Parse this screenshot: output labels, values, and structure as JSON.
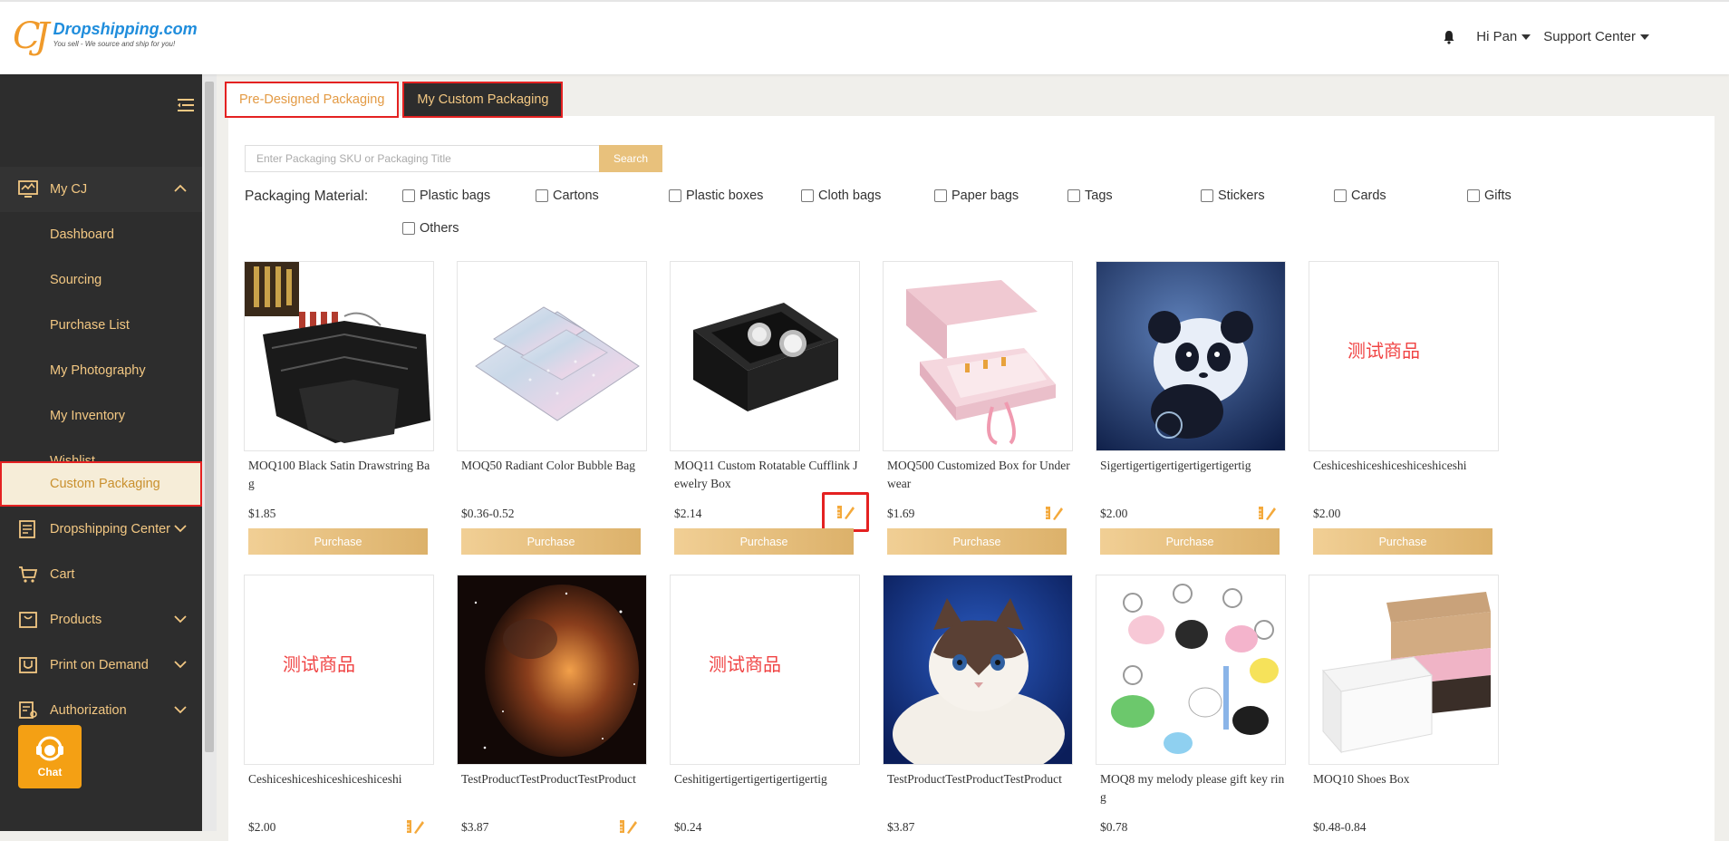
{
  "header": {
    "logo_mark": "CJ",
    "logo_name": "Dropshipping.com",
    "logo_tagline": "You sell - We source and ship for you!",
    "user_greeting": "Hi Pan",
    "support": "Support Center"
  },
  "sidebar": {
    "section_mycj": "My CJ",
    "sub_items": [
      "Dashboard",
      "Sourcing",
      "Purchase List",
      "My Photography",
      "My Inventory",
      "Wishlist",
      "Custom Packaging"
    ],
    "items": [
      "Dropshipping Center",
      "Cart",
      "Products",
      "Print on Demand",
      "Authorization"
    ],
    "chat": "Chat"
  },
  "tabs": {
    "pre_designed": "Pre-Designed Packaging",
    "my_custom": "My Custom Packaging"
  },
  "search": {
    "placeholder": "Enter Packaging SKU or Packaging Title",
    "button": "Search"
  },
  "filters": {
    "label": "Packaging Material:",
    "options": [
      "Plastic bags",
      "Cartons",
      "Plastic boxes",
      "Cloth bags",
      "Paper bags",
      "Tags",
      "Stickers",
      "Cards",
      "Gifts",
      "Others"
    ]
  },
  "products": [
    {
      "title": "MOQ100 Black Satin Drawstring Bag",
      "price": "$1.85",
      "image": "black-satin-bags"
    },
    {
      "title": "MOQ50 Radiant Color Bubble Bag",
      "price": "$0.36-0.52",
      "image": "holographic-bubble-bags"
    },
    {
      "title": "MOQ11 Custom Rotatable Cufflink Jewelry Box",
      "price": "$2.14",
      "image": "cufflink-box"
    },
    {
      "title": "MOQ500 Customized Box for Underwear",
      "price": "$1.69",
      "image": "pink-gift-box"
    },
    {
      "title": "Sigertigertigertigertigertigertig",
      "price": "$2.00",
      "image": "panda"
    },
    {
      "title": "Ceshiceshiceshiceshiceshiceshi",
      "price": "$2.00",
      "image": "test-text",
      "image_text": "测试商品"
    },
    {
      "title": "Ceshiceshiceshiceshiceshiceshi",
      "price": "$2.00",
      "image": "test-text",
      "image_text": "测试商品"
    },
    {
      "title": "TestProductTestProductTestProduct",
      "price": "$3.87",
      "image": "nebula"
    },
    {
      "title": "Ceshitigertigertigertigertigertig",
      "price": "$0.24",
      "image": "test-text",
      "image_text": "测试商品"
    },
    {
      "title": "TestProductTestProductTestProduct",
      "price": "$3.87",
      "image": "ragdoll-cat"
    },
    {
      "title": "MOQ8 my melody please gift key ring",
      "price": "$0.78",
      "image": "keychains"
    },
    {
      "title": "MOQ10 Shoes Box",
      "price": "$0.48-0.84",
      "image": "shoe-boxes"
    }
  ],
  "purchase_label": "Purchase",
  "colors": {
    "sidebar_bg": "#2d2d2d",
    "sidebar_text": "#f3c883",
    "accent_gold": "#e8c17c",
    "highlight_red": "#e42121"
  }
}
